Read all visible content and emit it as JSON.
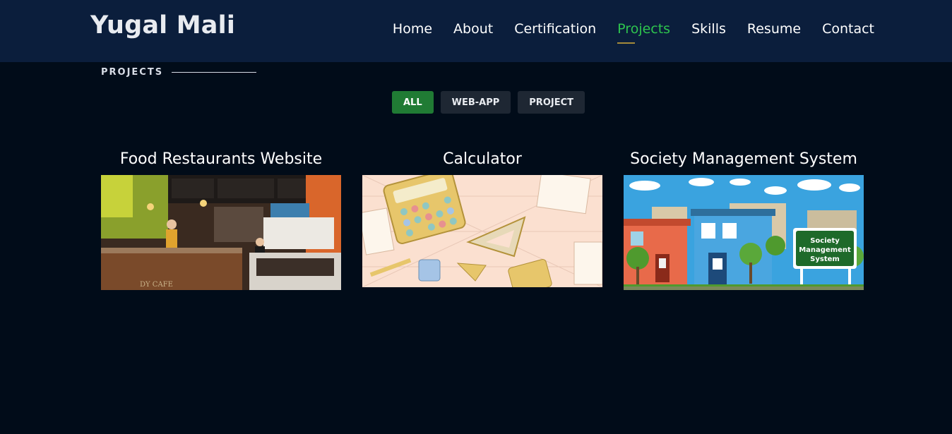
{
  "header": {
    "logo": "Yugal Mali"
  },
  "nav": {
    "items": [
      {
        "label": "Home"
      },
      {
        "label": "About"
      },
      {
        "label": "Certification"
      },
      {
        "label": "Projects"
      },
      {
        "label": "Skills"
      },
      {
        "label": "Resume"
      },
      {
        "label": "Contact"
      }
    ],
    "active": "Projects"
  },
  "section": {
    "title": "PROJECTS"
  },
  "filters": {
    "all": "ALL",
    "webapp": "WEB-APP",
    "project": "PROJECT",
    "active": "ALL"
  },
  "projects": [
    {
      "title": "Food Restaurants Website",
      "image": "restaurant-photo"
    },
    {
      "title": "Calculator",
      "image": "calculator-illustration"
    },
    {
      "title": "Society Management System",
      "image": "society-illustration",
      "sign_text": [
        "Society",
        "Management",
        "System"
      ]
    }
  ],
  "colors": {
    "accent": "#2ec44e",
    "header_bg": "#0b1e3c",
    "page_bg": "#010c19",
    "filter_active": "#207b34"
  }
}
